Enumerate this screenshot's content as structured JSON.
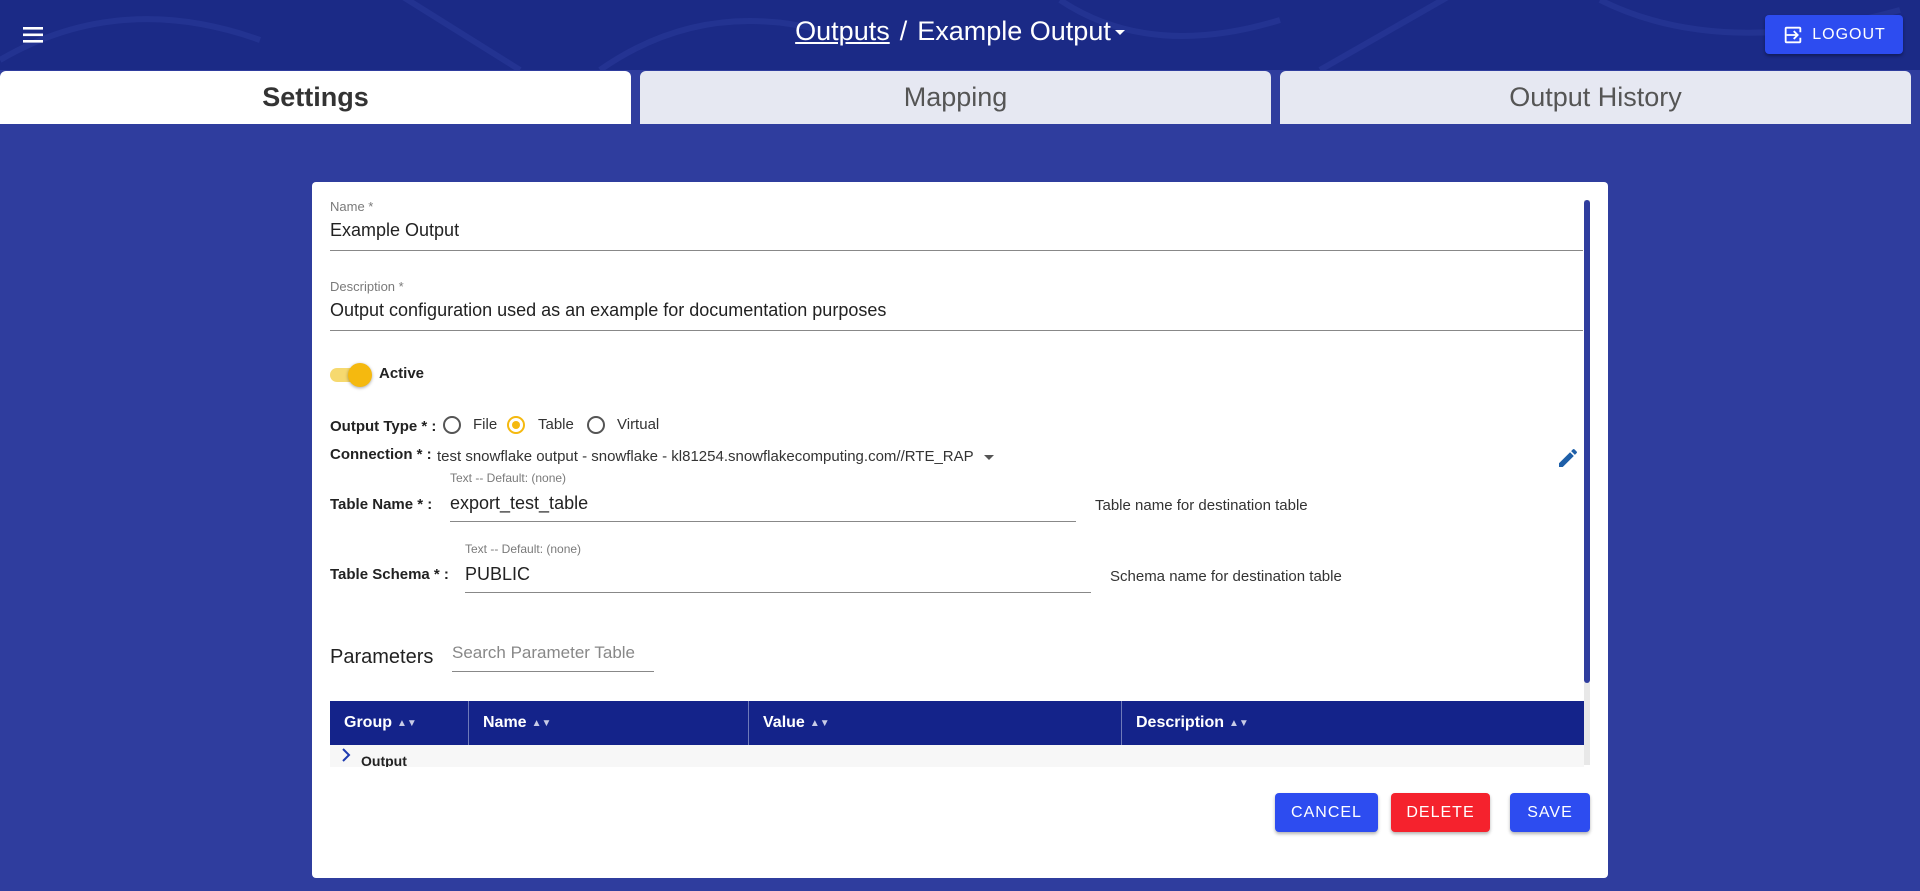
{
  "header": {
    "breadcrumb_link": "Outputs",
    "separator": "/",
    "current": "Example Output",
    "logout_label": "LOGOUT",
    "icons": {
      "menu": "menu-icon",
      "logout": "logout-icon",
      "dropdown": "caret-down-icon"
    }
  },
  "tabs": [
    {
      "label": "Settings",
      "active": true
    },
    {
      "label": "Mapping",
      "active": false
    },
    {
      "label": "Output History",
      "active": false
    }
  ],
  "form": {
    "name": {
      "label": "Name *",
      "value": "Example Output"
    },
    "description": {
      "label": "Description *",
      "value": "Output configuration used as an example for documentation purposes"
    },
    "active": {
      "label": "Active",
      "checked": true
    },
    "output_type": {
      "label": "Output Type * :",
      "options": [
        {
          "label": "File",
          "checked": false
        },
        {
          "label": "Table",
          "checked": true
        },
        {
          "label": "Virtual",
          "checked": false
        }
      ]
    },
    "connection": {
      "label": "Connection * :",
      "value": "test snowflake output - snowflake - kl81254.snowflakecomputing.com//RTE_RAP",
      "edit_icon": "pencil-icon"
    },
    "table_name": {
      "label": "Table Name * :",
      "hint": "Text -- Default: (none)",
      "value": "export_test_table",
      "help": "Table name for destination table"
    },
    "table_schema": {
      "label": "Table Schema * :",
      "hint": "Text -- Default: (none)",
      "value": "PUBLIC",
      "help": "Schema name for destination table"
    }
  },
  "parameters": {
    "title": "Parameters",
    "search_placeholder": "Search Parameter Table",
    "columns": [
      "Group",
      "Name",
      "Value",
      "Description"
    ],
    "rows": [
      {
        "group": "Output"
      }
    ]
  },
  "actions": {
    "cancel": "CANCEL",
    "delete": "DELETE",
    "save": "SAVE"
  },
  "colors": {
    "primary": "#2d4cf0",
    "header_bg": "#1b2a86",
    "page_bg": "#2f3d9e",
    "accent": "#f5b90f",
    "danger": "#f5222d",
    "table_header": "#14238a"
  }
}
